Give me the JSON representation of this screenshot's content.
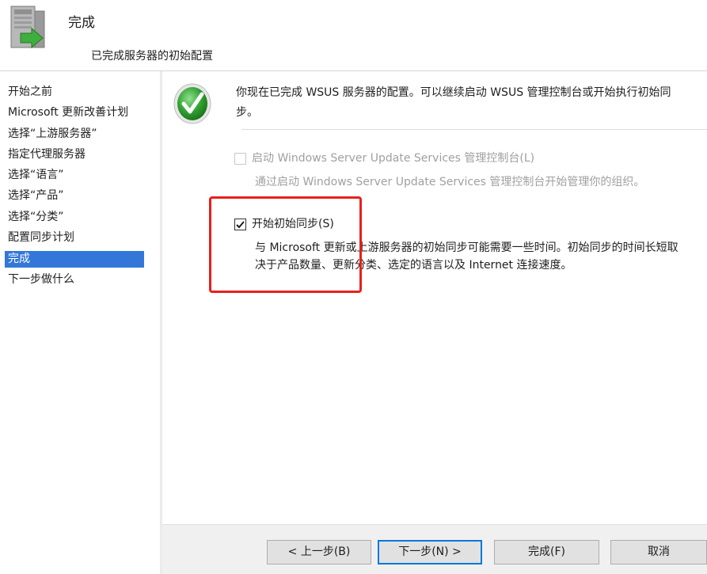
{
  "header": {
    "title": "完成",
    "subtitle": "已完成服务器的初始配置",
    "icon": "server-setup-icon"
  },
  "sidebar": {
    "items": [
      {
        "label": "开始之前",
        "active": false
      },
      {
        "label": "Microsoft 更新改善计划",
        "active": false
      },
      {
        "label": "选择“上游服务器”",
        "active": false
      },
      {
        "label": "指定代理服务器",
        "active": false
      },
      {
        "label": "选择“语言”",
        "active": false
      },
      {
        "label": "选择“产品”",
        "active": false
      },
      {
        "label": "选择“分类”",
        "active": false
      },
      {
        "label": "配置同步计划",
        "active": false
      },
      {
        "label": "完成",
        "active": true
      },
      {
        "label": "下一步做什么",
        "active": false
      }
    ]
  },
  "main": {
    "message_line1": "你现在已完成 WSUS 服务器的配置。可以继续启动 WSUS 管理控制台或开始执行初始同",
    "message_line2": "步。",
    "launch_console": {
      "label": "启动 Windows Server Update Services 管理控制台(L)",
      "description": "通过启动 Windows Server Update Services 管理控制台开始管理你的组织。",
      "checked": false,
      "enabled": false
    },
    "begin_sync": {
      "label": "开始初始同步(S)",
      "description_line1": "与 Microsoft 更新或上游服务器的初始同步可能需要一些时间。初始同步的时间长短取",
      "description_line2": "决于产品数量、更新分类、选定的语言以及 Internet 连接速度。",
      "checked": true,
      "enabled": true
    },
    "success_icon": "checkmark-icon"
  },
  "buttons": {
    "back": "< 上一步(B)",
    "next": "下一步(N) >",
    "finish": "完成(F)",
    "cancel": "取消"
  },
  "colors": {
    "selection": "#3377d8",
    "highlight_border": "#e8201c",
    "success": "#2e9e2e"
  }
}
